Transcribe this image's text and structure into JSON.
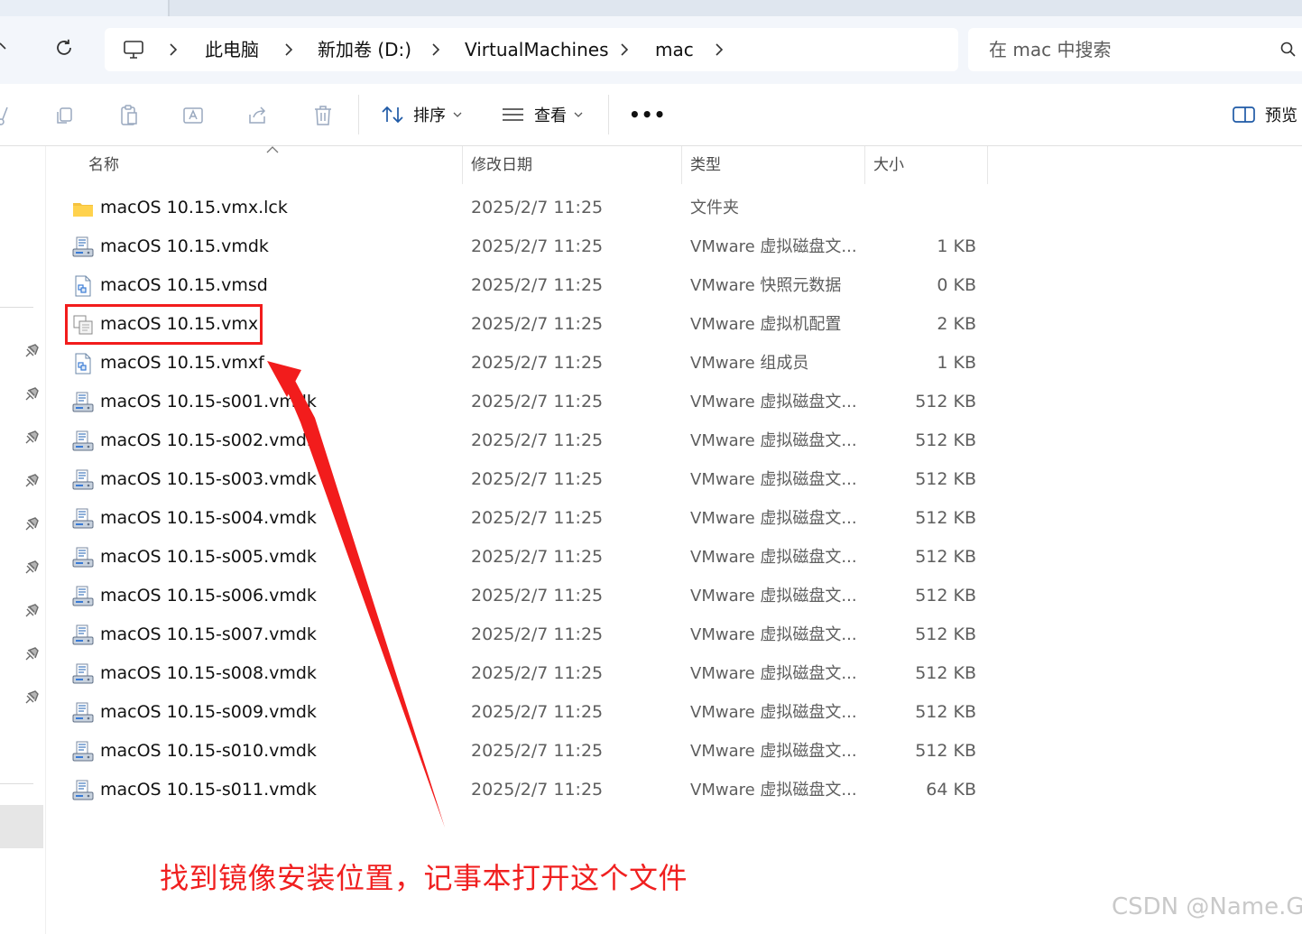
{
  "breadcrumb": {
    "items": [
      "此电脑",
      "新加卷 (D:)",
      "VirtualMachines",
      "mac"
    ]
  },
  "search": {
    "placeholder": "在 mac 中搜索"
  },
  "toolbar": {
    "sort_label": "排序",
    "view_label": "查看",
    "more_label": "•••",
    "preview_label": "预览"
  },
  "columns": {
    "name": "名称",
    "date": "修改日期",
    "type": "类型",
    "size": "大小"
  },
  "files": [
    {
      "name": "macOS 10.15.vmx.lck",
      "date": "2025/2/7 11:25",
      "type": "文件夹",
      "size": "",
      "icon": "folder-icon"
    },
    {
      "name": "macOS 10.15.vmdk",
      "date": "2025/2/7 11:25",
      "type": "VMware 虚拟磁盘文...",
      "size": "1 KB",
      "icon": "disk-file-icon"
    },
    {
      "name": "macOS 10.15.vmsd",
      "date": "2025/2/7 11:25",
      "type": "VMware 快照元数据",
      "size": "0 KB",
      "icon": "vmware-doc-icon"
    },
    {
      "name": "macOS 10.15.vmx",
      "date": "2025/2/7 11:25",
      "type": "VMware 虚拟机配置",
      "size": "2 KB",
      "icon": "vm-config-icon"
    },
    {
      "name": "macOS 10.15.vmxf",
      "date": "2025/2/7 11:25",
      "type": "VMware 组成员",
      "size": "1 KB",
      "icon": "vmware-doc-icon"
    },
    {
      "name": "macOS 10.15-s001.vmdk",
      "date": "2025/2/7 11:25",
      "type": "VMware 虚拟磁盘文...",
      "size": "512 KB",
      "icon": "disk-file-icon"
    },
    {
      "name": "macOS 10.15-s002.vmdk",
      "date": "2025/2/7 11:25",
      "type": "VMware 虚拟磁盘文...",
      "size": "512 KB",
      "icon": "disk-file-icon"
    },
    {
      "name": "macOS 10.15-s003.vmdk",
      "date": "2025/2/7 11:25",
      "type": "VMware 虚拟磁盘文...",
      "size": "512 KB",
      "icon": "disk-file-icon"
    },
    {
      "name": "macOS 10.15-s004.vmdk",
      "date": "2025/2/7 11:25",
      "type": "VMware 虚拟磁盘文...",
      "size": "512 KB",
      "icon": "disk-file-icon"
    },
    {
      "name": "macOS 10.15-s005.vmdk",
      "date": "2025/2/7 11:25",
      "type": "VMware 虚拟磁盘文...",
      "size": "512 KB",
      "icon": "disk-file-icon"
    },
    {
      "name": "macOS 10.15-s006.vmdk",
      "date": "2025/2/7 11:25",
      "type": "VMware 虚拟磁盘文...",
      "size": "512 KB",
      "icon": "disk-file-icon"
    },
    {
      "name": "macOS 10.15-s007.vmdk",
      "date": "2025/2/7 11:25",
      "type": "VMware 虚拟磁盘文...",
      "size": "512 KB",
      "icon": "disk-file-icon"
    },
    {
      "name": "macOS 10.15-s008.vmdk",
      "date": "2025/2/7 11:25",
      "type": "VMware 虚拟磁盘文...",
      "size": "512 KB",
      "icon": "disk-file-icon"
    },
    {
      "name": "macOS 10.15-s009.vmdk",
      "date": "2025/2/7 11:25",
      "type": "VMware 虚拟磁盘文...",
      "size": "512 KB",
      "icon": "disk-file-icon"
    },
    {
      "name": "macOS 10.15-s010.vmdk",
      "date": "2025/2/7 11:25",
      "type": "VMware 虚拟磁盘文...",
      "size": "512 KB",
      "icon": "disk-file-icon"
    },
    {
      "name": "macOS 10.15-s011.vmdk",
      "date": "2025/2/7 11:25",
      "type": "VMware 虚拟磁盘文...",
      "size": "64 KB",
      "icon": "disk-file-icon"
    }
  ],
  "annotation": {
    "text": "找到镜像安装位置，记事本打开这个文件",
    "color": "#f21c1c"
  },
  "watermark": "CSDN @Name.Gy"
}
